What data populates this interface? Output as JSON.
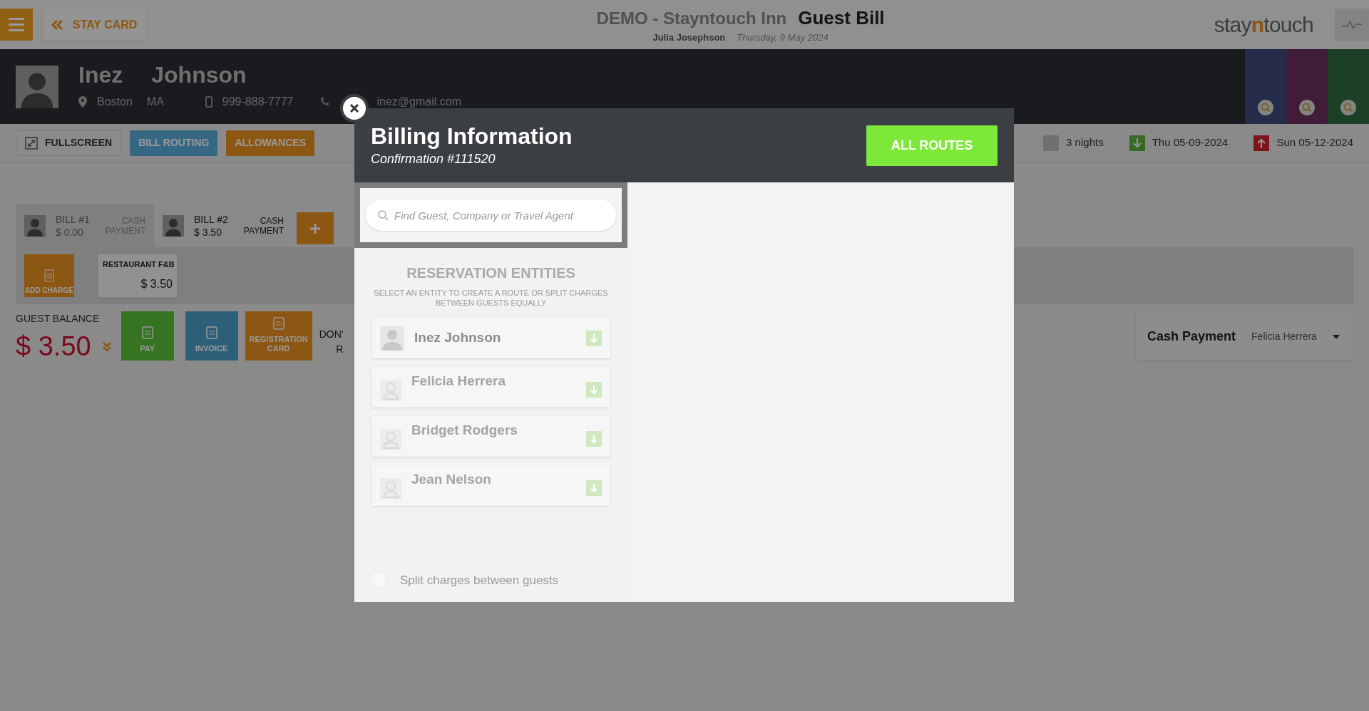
{
  "top_bar": {
    "back_button": "STAY CARD",
    "hotel": "DEMO - Stayntouch Inn",
    "page_title": "Guest Bill",
    "user": "Julia Josephson",
    "date": "Thursday, 9 May 2024",
    "logo": [
      "stay",
      "n",
      "touch"
    ]
  },
  "guest": {
    "first_name": "Inez",
    "last_name": "Johnson",
    "city": "Boston",
    "state": "MA",
    "phone": "999-888-7777",
    "email": "inez@gmail.com"
  },
  "toolbar": [
    {
      "label": "FULLSCREEN",
      "kind": "plain"
    },
    {
      "label": "BILL ROUTING",
      "kind": "blue"
    },
    {
      "label": "ALLOWANCES",
      "kind": "orange"
    }
  ],
  "stay": {
    "nights": "3 nights",
    "arrival": "Thu 05-09-2024",
    "departure": "Sun 05-12-2024"
  },
  "bills": [
    {
      "label": "BILL #1",
      "amount": "$ 0.00",
      "payment": "CASH PAYMENT",
      "selected": false
    },
    {
      "label": "BILL #2",
      "amount": "$ 3.50",
      "payment": "CASH PAYMENT",
      "selected": true
    }
  ],
  "add_charge": "ADD CHARGE",
  "charges": [
    {
      "label": "RESTAURANT F&B",
      "amount": "$ 3.50"
    }
  ],
  "balance": {
    "label": "GUEST BALANCE",
    "amount": "$ 3.50"
  },
  "actions": [
    {
      "label": "PAY",
      "kind": "pay"
    },
    {
      "label": "INVOICE",
      "kind": "invoice"
    },
    {
      "label": "REGISTRATION CARD",
      "kind": "registration"
    }
  ],
  "cut_text": [
    "DON'",
    "R"
  ],
  "payment_card": {
    "method": "Cash Payment",
    "guest": "Felicia Herrera"
  },
  "modal": {
    "title": "Billing Information",
    "confirmation": "Confirmation #111520",
    "all_routes_button": "ALL ROUTES",
    "search": {
      "placeholder": "Find Guest, Company or Travel Agent"
    },
    "entities_heading": "RESERVATION ENTITIES",
    "entities_hint": "SELECT AN ENTITY TO CREATE A ROUTE OR SPLIT CHARGES BETWEEN GUESTS EQUALLY",
    "entities": [
      {
        "name": "Inez Johnson",
        "kind": "primary"
      },
      {
        "name": "Felicia Herrera",
        "kind": "accompanying"
      },
      {
        "name": "Bridget Rodgers",
        "kind": "accompanying"
      },
      {
        "name": "Jean Nelson",
        "kind": "accompanying"
      }
    ],
    "split_checkbox": {
      "label": "Split charges between guests",
      "checked": false
    }
  }
}
